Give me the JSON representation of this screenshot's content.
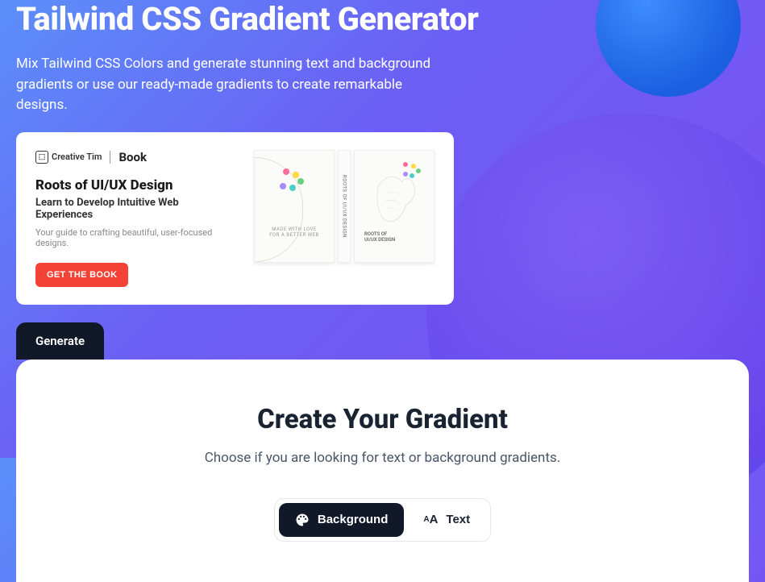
{
  "hero": {
    "title": "Tailwind CSS Gradient Generator",
    "subtitle": "Mix Tailwind CSS Colors and generate stunning text and background gradients or use our ready-made gradients to create remarkable designs."
  },
  "promo": {
    "brand": "Creative Tim",
    "label": "Book",
    "title": "Roots of UI/UX Design",
    "subtitle": "Learn to Develop Intuitive Web Experiences",
    "description": "Your guide to crafting beautiful, user-focused designs.",
    "cta": "GET THE  BOOK",
    "cover_text": "MADE WITH LOVE\nFOR A BETTER WEB",
    "spine_text": "ROOTS OF UI/UX DESIGN",
    "back_text": "ROOTS OF\nUI/UX DESIGN"
  },
  "tabs": {
    "generate": "Generate"
  },
  "panel": {
    "title": "Create Your Gradient",
    "subtitle": "Choose if you are looking for text or background gradients.",
    "toggle": {
      "background": "Background",
      "text": "Text"
    }
  },
  "colors": {
    "accent": "#f44336",
    "dark": "#111827"
  }
}
